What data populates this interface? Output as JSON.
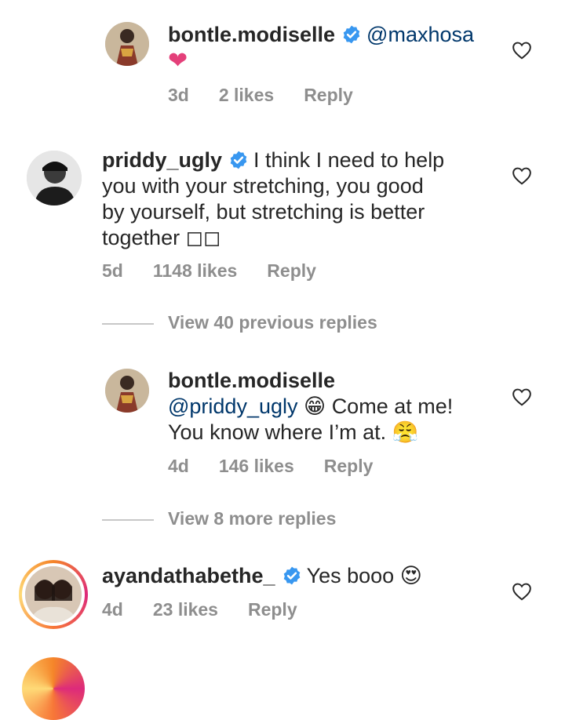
{
  "comments": [
    {
      "username": "bontle.modiselle",
      "mention": "@maxhosa",
      "text": "",
      "emoji": "❤",
      "time": "3d",
      "likes": "2 likes",
      "reply": "Reply"
    },
    {
      "username": "priddy_ugly",
      "text_lines": [
        "I think I need to help",
        "you with your stretching, you good",
        "by yourself, but stretching is better",
        "together ◻◻"
      ],
      "time": "5d",
      "likes": "1148 likes",
      "reply": "Reply"
    },
    {
      "username": "bontle.modiselle",
      "mention": "@priddy_ugly",
      "emoji1": "😁",
      "text_a": "Come at me!",
      "text_b": "You know where I’m at.",
      "emoji2": "😤",
      "time": "4d",
      "likes": "146 likes",
      "reply": "Reply"
    },
    {
      "username": "ayandathabethe_",
      "text": "Yes booo",
      "emoji": "😍",
      "time": "4d",
      "likes": "23 likes",
      "reply": "Reply"
    }
  ],
  "view_previous": "View 40 previous replies",
  "view_more": "View 8 more replies",
  "icons": {
    "verified": "verified-badge-icon",
    "like": "heart-outline-icon"
  },
  "colors": {
    "verified": "#3897f0",
    "mention": "#00376b",
    "meta": "#8e8e8e"
  }
}
